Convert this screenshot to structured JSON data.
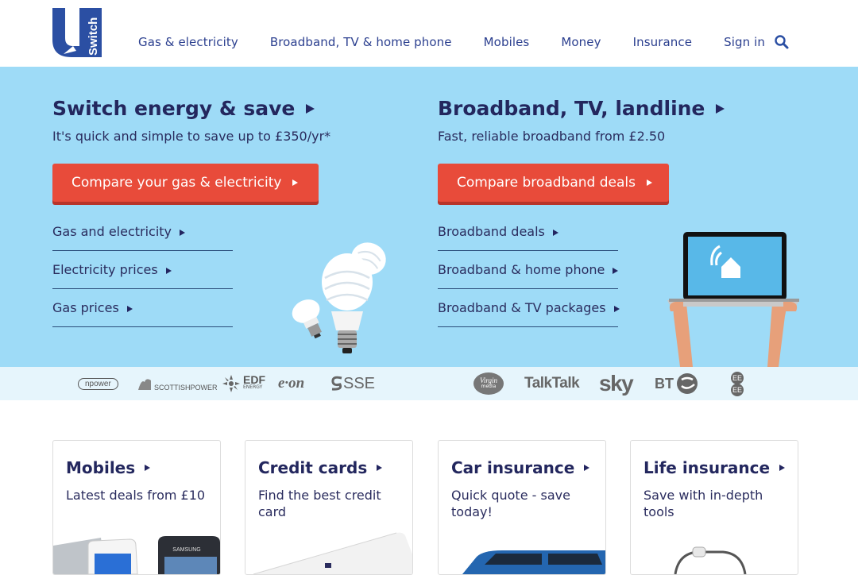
{
  "header": {
    "logo_text": "Switch",
    "nav": [
      "Gas & electricity",
      "Broadband, TV & home phone",
      "Mobiles",
      "Money",
      "Insurance",
      "Sign in"
    ]
  },
  "hero": {
    "energy": {
      "title": "Switch energy & save",
      "subtitle": "It's quick and simple to save up to £350/yr*",
      "cta": "Compare your gas & electricity",
      "links": [
        "Gas and electricity",
        "Electricity prices",
        "Gas prices"
      ]
    },
    "broadband": {
      "title": "Broadband, TV, landline",
      "subtitle": "Fast, reliable broadband from £2.50",
      "cta": "Compare broadband deals",
      "links": [
        "Broadband deals",
        "Broadband & home phone",
        "Broadband & TV packages"
      ]
    }
  },
  "brands": {
    "npower": "npower",
    "scottishpower": "SCOTTISHPOWER",
    "edf": "EDF",
    "edf_sub": "ENERGY",
    "eon": "e·on",
    "sse": "SSE",
    "virgin": "Virgin",
    "virgin_sub": "media",
    "talktalk": "TalkTalk",
    "sky": "sky",
    "bt": "BT",
    "ee": "EE"
  },
  "cards": [
    {
      "title": "Mobiles",
      "text": "Latest deals from £10",
      "phone_brand": "SAMSUNG"
    },
    {
      "title": "Credit cards",
      "text": "Find the best credit card"
    },
    {
      "title": "Car insurance",
      "text": "Quick quote - save today!"
    },
    {
      "title": "Life insurance",
      "text": "Save with in-depth tools"
    }
  ]
}
